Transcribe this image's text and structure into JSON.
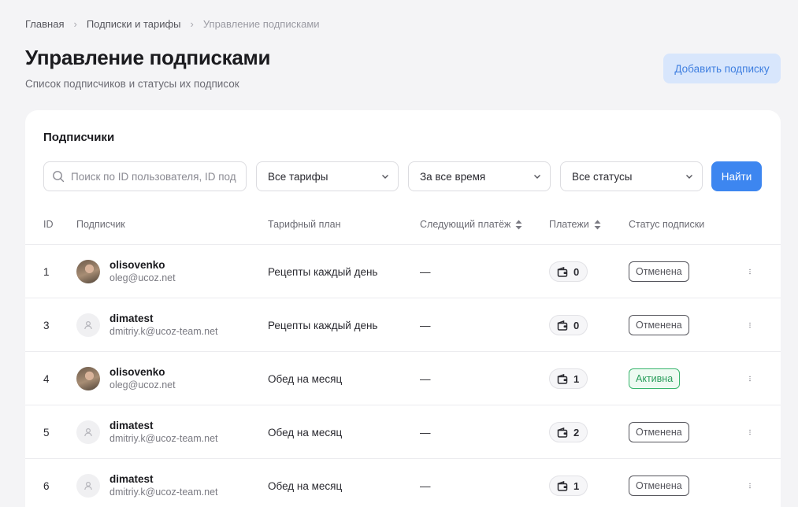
{
  "breadcrumb": {
    "home": "Главная",
    "section": "Подписки и тарифы",
    "current": "Управление подписками"
  },
  "header": {
    "title": "Управление подписками",
    "subtitle": "Список подписчиков и статусы их подписок",
    "add_button": "Добавить подписку"
  },
  "card": {
    "title": "Подписчики",
    "filters": {
      "search_placeholder": "Поиск по ID пользователя, ID подписки",
      "plan": "Все тарифы",
      "period": "За все время",
      "status": "Все статусы",
      "find_button": "Найти"
    },
    "columns": {
      "id": "ID",
      "subscriber": "Подписчик",
      "plan": "Тарифный план",
      "next_payment": "Следующий платёж",
      "payments": "Платежи",
      "status": "Статус подписки"
    },
    "rows": [
      {
        "id": "1",
        "name": "olisovenko",
        "email": "oleg@ucoz.net",
        "avatar": "photo",
        "plan": "Рецепты каждый день",
        "next": "—",
        "payments": "0",
        "status": "Отменена",
        "status_type": "cancel"
      },
      {
        "id": "3",
        "name": "dimatest",
        "email": "dmitriy.k@ucoz-team.net",
        "avatar": "blank",
        "plan": "Рецепты каждый день",
        "next": "—",
        "payments": "0",
        "status": "Отменена",
        "status_type": "cancel"
      },
      {
        "id": "4",
        "name": "olisovenko",
        "email": "oleg@ucoz.net",
        "avatar": "photo",
        "plan": "Обед на месяц",
        "next": "—",
        "payments": "1",
        "status": "Активна",
        "status_type": "active"
      },
      {
        "id": "5",
        "name": "dimatest",
        "email": "dmitriy.k@ucoz-team.net",
        "avatar": "blank",
        "plan": "Обед на месяц",
        "next": "—",
        "payments": "2",
        "status": "Отменена",
        "status_type": "cancel"
      },
      {
        "id": "6",
        "name": "dimatest",
        "email": "dmitriy.k@ucoz-team.net",
        "avatar": "blank",
        "plan": "Обед на месяц",
        "next": "—",
        "payments": "1",
        "status": "Отменена",
        "status_type": "cancel"
      }
    ]
  },
  "colors": {
    "accent": "#3d86f0",
    "active": "#2a9d5c",
    "cancelled": "#55555c"
  }
}
